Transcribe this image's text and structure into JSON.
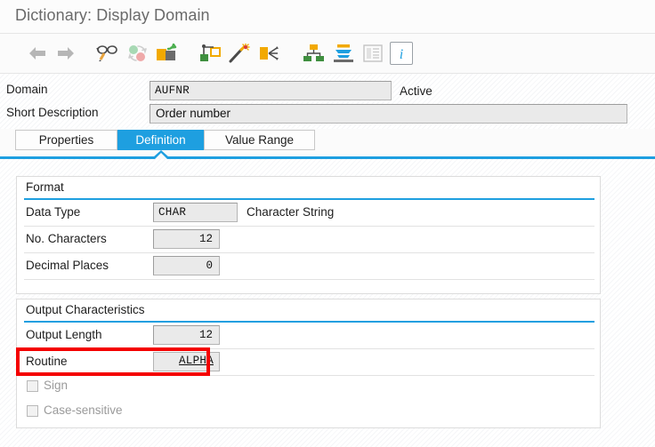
{
  "window": {
    "title": "Dictionary: Display Domain"
  },
  "toolbar": {
    "items": [
      {
        "name": "back-arrow-icon",
        "tooltip": "Back"
      },
      {
        "name": "forward-arrow-icon",
        "tooltip": "Forward"
      },
      {
        "name": "display-change-icon",
        "tooltip": "Display <-> Change"
      },
      {
        "name": "refresh-icon",
        "tooltip": "Refresh"
      },
      {
        "name": "activate-icon",
        "tooltip": "Activate"
      },
      {
        "name": "where-used-icon",
        "tooltip": "Where-Used List"
      },
      {
        "name": "magic-wand-icon",
        "tooltip": "Generate"
      },
      {
        "name": "expand-icon",
        "tooltip": "Expand"
      },
      {
        "name": "hierarchy-icon",
        "tooltip": "Hierarchy Display"
      },
      {
        "name": "layers-icon",
        "tooltip": "Database Object"
      },
      {
        "name": "list-icon",
        "tooltip": "Documentation"
      },
      {
        "name": "info-icon",
        "tooltip": "Technical Information"
      }
    ]
  },
  "header": {
    "domain_label": "Domain",
    "domain_value": "AUFNR",
    "status": "Active",
    "short_description_label": "Short Description",
    "short_description_value": "Order number"
  },
  "tabs": [
    {
      "label": "Properties",
      "active": false
    },
    {
      "label": "Definition",
      "active": true
    },
    {
      "label": "Value Range",
      "active": false
    }
  ],
  "format_section": {
    "title": "Format",
    "rows": [
      {
        "label": "Data Type",
        "value": "CHAR",
        "aux": "Character String",
        "align": "left"
      },
      {
        "label": "No. Characters",
        "value": "12",
        "aux": "",
        "align": "right"
      },
      {
        "label": "Decimal Places",
        "value": "0",
        "aux": "",
        "align": "right"
      }
    ]
  },
  "output_section": {
    "title": "Output Characteristics",
    "rows": [
      {
        "label": "Output Length",
        "value": "12",
        "align": "right"
      },
      {
        "label": "Routine",
        "value": "ALPHA",
        "align": "right"
      }
    ],
    "checkboxes": [
      {
        "label": "Sign",
        "checked": false,
        "disabled": true
      },
      {
        "label": "Case-sensitive",
        "checked": false,
        "disabled": true
      }
    ]
  },
  "annotation": {
    "color": "#f40000",
    "target": "Routine"
  }
}
